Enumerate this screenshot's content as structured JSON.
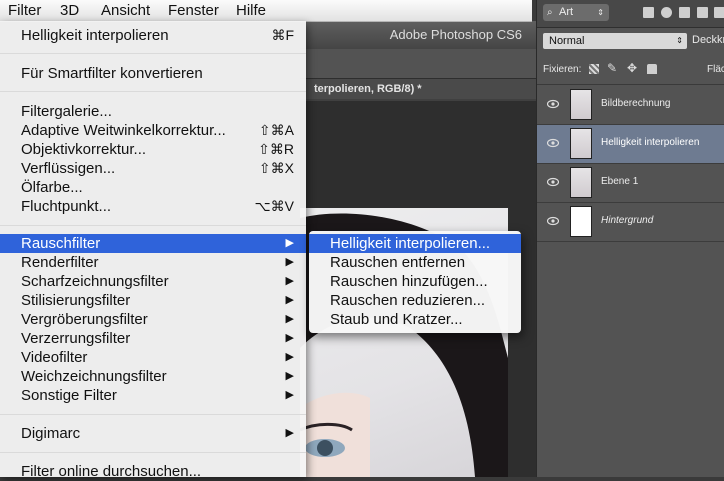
{
  "menubar": {
    "items": [
      {
        "label": "Filter",
        "active": true
      },
      {
        "label": "3D"
      },
      {
        "label": "Ansicht"
      },
      {
        "label": "Fenster"
      },
      {
        "label": "Hilfe"
      }
    ]
  },
  "app": {
    "title": "Adobe Photoshop CS6",
    "document_tab": "terpolieren, RGB/8) *"
  },
  "filter_menu": {
    "last_filter": {
      "label": "Helligkeit interpolieren",
      "shortcut": "⌘F"
    },
    "smart_filter": "Für Smartfilter konvertieren",
    "items_group1": [
      {
        "label": "Filtergalerie...",
        "shortcut": ""
      },
      {
        "label": "Adaptive Weitwinkelkorrektur...",
        "shortcut": "⇧⌘A"
      },
      {
        "label": "Objektivkorrektur...",
        "shortcut": "⇧⌘R"
      },
      {
        "label": "Verflüssigen...",
        "shortcut": "⇧⌘X"
      },
      {
        "label": "Ölfarbe...",
        "shortcut": ""
      },
      {
        "label": "Fluchtpunkt...",
        "shortcut": "⌥⌘V"
      }
    ],
    "submenus": [
      {
        "label": "Rauschfilter",
        "highlighted": true
      },
      {
        "label": "Renderfilter"
      },
      {
        "label": "Scharfzeichnungsfilter"
      },
      {
        "label": "Stilisierungsfilter"
      },
      {
        "label": "Vergröberungsfilter"
      },
      {
        "label": "Verzerrungsfilter"
      },
      {
        "label": "Videofilter"
      },
      {
        "label": "Weichzeichnungsfilter"
      },
      {
        "label": "Sonstige Filter"
      }
    ],
    "digimarc": "Digimarc",
    "browse_online": "Filter online durchsuchen...",
    "arrow": "▶"
  },
  "noise_submenu": {
    "items": [
      {
        "label": "Helligkeit interpolieren...",
        "highlighted": true
      },
      {
        "label": "Rauschen entfernen"
      },
      {
        "label": "Rauschen hinzufügen..."
      },
      {
        "label": "Rauschen reduzieren..."
      },
      {
        "label": "Staub und Kratzer..."
      }
    ]
  },
  "layers_panel": {
    "kind_filter": "Art",
    "blend_mode": "Normal",
    "opacity_label": "Deckkr",
    "lock_label": "Fixieren:",
    "fill_label": "Fläc",
    "layers": [
      {
        "name": "Bildberechnung",
        "thumb": "portrait",
        "selected": false,
        "italic": false
      },
      {
        "name": "Helligkeit interpolieren",
        "thumb": "portrait",
        "selected": true,
        "italic": false
      },
      {
        "name": "Ebene 1",
        "thumb": "portrait",
        "selected": false,
        "italic": false
      },
      {
        "name": "Hintergrund",
        "thumb": "white",
        "selected": false,
        "italic": true
      }
    ]
  },
  "colors": {
    "highlight": "#2f63da",
    "selected_layer": "#6e7b91"
  }
}
